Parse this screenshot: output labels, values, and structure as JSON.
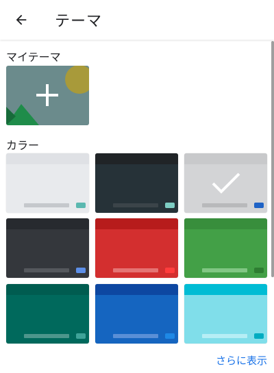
{
  "header": {
    "title": "テーマ"
  },
  "my_theme": {
    "section_title": "マイテーマ"
  },
  "colors": {
    "section_title": "カラー",
    "themes": [
      {
        "name": "light",
        "top": "#dfe1e5",
        "body": "#e8eaed",
        "bar": "#c5c8cc",
        "key": "#5bb8b0",
        "selected": false
      },
      {
        "name": "dark-slate",
        "top": "#202427",
        "body": "#263238",
        "bar": "#3b4449",
        "key": "#7dcdc3",
        "selected": false
      },
      {
        "name": "gray",
        "top": "#c8c9cb",
        "body": "#d3d4d6",
        "bar": "#b8b9bb",
        "key": "#1f63c6",
        "selected": true
      },
      {
        "name": "charcoal",
        "top": "#272a2f",
        "body": "#34373c",
        "bar": "#55585d",
        "key": "#5d8fe8",
        "selected": false
      },
      {
        "name": "red",
        "top": "#b71c1c",
        "body": "#d32f2f",
        "bar": "#e57373",
        "key": "#ff3d3d",
        "selected": false
      },
      {
        "name": "green",
        "top": "#388e3c",
        "body": "#43a047",
        "bar": "#81c784",
        "key": "#2e7d32",
        "selected": false
      },
      {
        "name": "teal",
        "top": "#005c50",
        "body": "#00695c",
        "bar": "#4d968c",
        "key": "#3ea398",
        "selected": false
      },
      {
        "name": "blue",
        "top": "#0d47a1",
        "body": "#1565c0",
        "bar": "#5a8fd6",
        "key": "#1e88e5",
        "selected": false
      },
      {
        "name": "cyan",
        "top": "#00bcd4",
        "body": "#80deea",
        "bar": "#b6eef5",
        "key": "#00acc1",
        "selected": false
      }
    ]
  },
  "more_link": "さらに表示"
}
